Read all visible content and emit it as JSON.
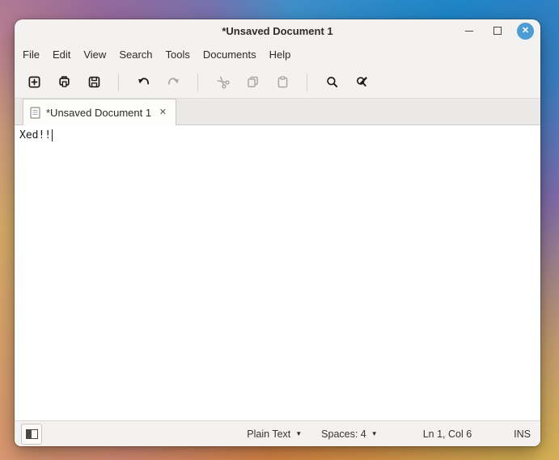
{
  "window": {
    "title": "*Unsaved Document 1"
  },
  "icons": {
    "close_glyph": "✕",
    "tab_close_glyph": "✕",
    "dropdown_arrow": "▼"
  },
  "colors": {
    "close_button_bg": "#4b9dd3",
    "window_bg": "#f4f2f1",
    "editor_bg": "#ffffff",
    "icon_enabled": "#1c1b1a",
    "icon_disabled": "#aaa7a4"
  },
  "menubar": {
    "items": [
      "File",
      "Edit",
      "View",
      "Search",
      "Tools",
      "Documents",
      "Help"
    ]
  },
  "toolbar": {
    "buttons": [
      {
        "name": "new",
        "enabled": true
      },
      {
        "name": "open",
        "enabled": true
      },
      {
        "name": "save",
        "enabled": true
      },
      {
        "name": "undo",
        "enabled": true
      },
      {
        "name": "redo",
        "enabled": false
      },
      {
        "name": "cut",
        "enabled": false
      },
      {
        "name": "copy",
        "enabled": false
      },
      {
        "name": "paste",
        "enabled": false
      },
      {
        "name": "find",
        "enabled": true
      },
      {
        "name": "replace",
        "enabled": true
      }
    ]
  },
  "tabbar": {
    "tabs": [
      {
        "label": "*Unsaved Document 1",
        "active": true
      }
    ]
  },
  "editor": {
    "text": "Xed!!"
  },
  "statusbar": {
    "language_selector": "Plain Text",
    "tab_width_selector": "Spaces: 4",
    "cursor_position": "Ln 1, Col 6",
    "input_mode": "INS"
  }
}
